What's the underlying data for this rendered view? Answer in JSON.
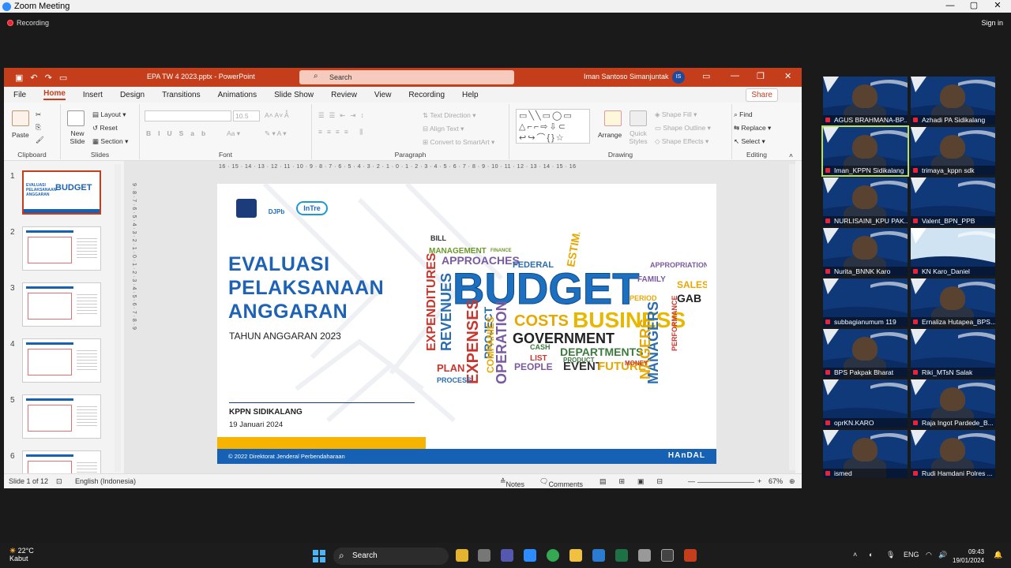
{
  "zoom": {
    "window_title": "Zoom Meeting",
    "recording_label": "Recording",
    "sign_in_label": "Sign in"
  },
  "ppt": {
    "file_name": "EPA TW 4 2023.pptx",
    "app_name": "PowerPoint",
    "search_placeholder": "Search",
    "user_name": "Iman Santoso Simanjuntak",
    "user_initials": "IS",
    "tabs": [
      "File",
      "Home",
      "Insert",
      "Design",
      "Transitions",
      "Animations",
      "Slide Show",
      "Review",
      "View",
      "Recording",
      "Help"
    ],
    "active_tab": "Home",
    "share_label": "Share",
    "ribbon": {
      "clipboard": {
        "label": "Clipboard",
        "paste": "Paste"
      },
      "slides": {
        "label": "Slides",
        "new_slide": "New Slide",
        "layout": "Layout",
        "reset": "Reset",
        "section": "Section"
      },
      "font": {
        "label": "Font",
        "font_size": "10.5"
      },
      "paragraph": {
        "label": "Paragraph",
        "text_direction": "Text Direction",
        "align_text": "Align Text",
        "convert": "Convert to SmartArt"
      },
      "drawing": {
        "label": "Drawing",
        "arrange": "Arrange",
        "quick_styles": "Quick Styles",
        "shape_fill": "Shape Fill",
        "shape_outline": "Shape Outline",
        "shape_effects": "Shape Effects"
      },
      "editing": {
        "label": "Editing",
        "find": "Find",
        "replace": "Replace",
        "select": "Select"
      }
    },
    "thumbnail_numbers": [
      "1",
      "2",
      "3",
      "4",
      "5",
      "6"
    ],
    "thumbnail_titles": [
      "BUDGET",
      "",
      "",
      "",
      "",
      ""
    ],
    "ruler_h": "16 · 15 · 14 · 13 · 12 · 11 · 10 · 9 · 8 · 7 · 6 · 5 · 4 · 3 · 2 · 1 · 0 · 1 · 2 · 3 · 4 · 5 · 6 · 7 · 8 · 9 · 10 · 11 · 12 · 13 · 14 · 15 · 16",
    "ruler_v": "9 · 8 · 7 · 6 · 5 · 4 · 3 · 2 · 1 · 0 · 1 · 2 · 3 · 4 · 5 · 6 · 7 · 8 · 9",
    "slide": {
      "logo_djpb": "DJPb",
      "logo_intress": "InTre",
      "title_lines": [
        "EVALUASI",
        "PELAKSANAAN",
        "ANGGARAN"
      ],
      "subtitle": "TAHUN ANGGARAN 2023",
      "org": "KPPN SIDIKALANG",
      "date": "19 Januari 2024",
      "footer_copyright": "© 2022 Direktorat Jenderal Perbendaharaan",
      "footer_brand": "HAnDAL",
      "wordcloud": [
        "BILL",
        "MANAGEMENT",
        "FINANCE",
        "APPROACHES",
        "EXPENDITURES",
        "REVENUES",
        "BUDGET",
        "COSTS",
        "BUSINESS",
        "GOVERNMENT",
        "DEPARTMENTS",
        "EXPENSES",
        "OPERATION",
        "EVENT",
        "FUTURE",
        "PLAN",
        "PEOPLE",
        "SALES",
        "GAB",
        "FEDERAL",
        "FAMILY",
        "ESTIMA",
        "PERIOD",
        "PROJECT",
        "COMPANIES",
        "PROCESS",
        "MANAGERS",
        "NAGERS",
        "PERFORMANCE",
        "APPROPRIATIONS",
        "PRODUCT",
        "MONEY",
        "CASH",
        "LIST"
      ]
    },
    "status": {
      "slide_info": "Slide 1 of 12",
      "language": "English (Indonesia)",
      "notes": "Notes",
      "comments": "Comments",
      "zoom": "67%"
    }
  },
  "participants": [
    "AGUS BRAHMANA-BP...",
    "Azhadi PA Sidikalang",
    "Iman_KPPN Sidikalang",
    "trimaya_kppn sdk",
    "NURLISAINI_KPU PAK...",
    "Valent_BPN_PPB",
    "Nurita_BNNK Karo",
    "KN Karo_Daniel",
    "subbagianumum 119",
    "Ernaliza Hutapea_BPS...",
    "BPS Pakpak Bharat",
    "Riki_MTsN Salak",
    "oprKN.KARO",
    "Raja Ingot Pardede_B...",
    "ismed",
    "Rudi Hamdani Polres ..."
  ],
  "taskbar": {
    "temp": "22°C",
    "weather": "Kabut",
    "search_placeholder": "Search",
    "language": "ENG",
    "time": "09:43",
    "date": "19/01/2024"
  },
  "colors": {
    "ppt_accent": "#c43e1c",
    "zoom_blue": "#2d8cff",
    "slide_blue": "#1d62b5"
  }
}
